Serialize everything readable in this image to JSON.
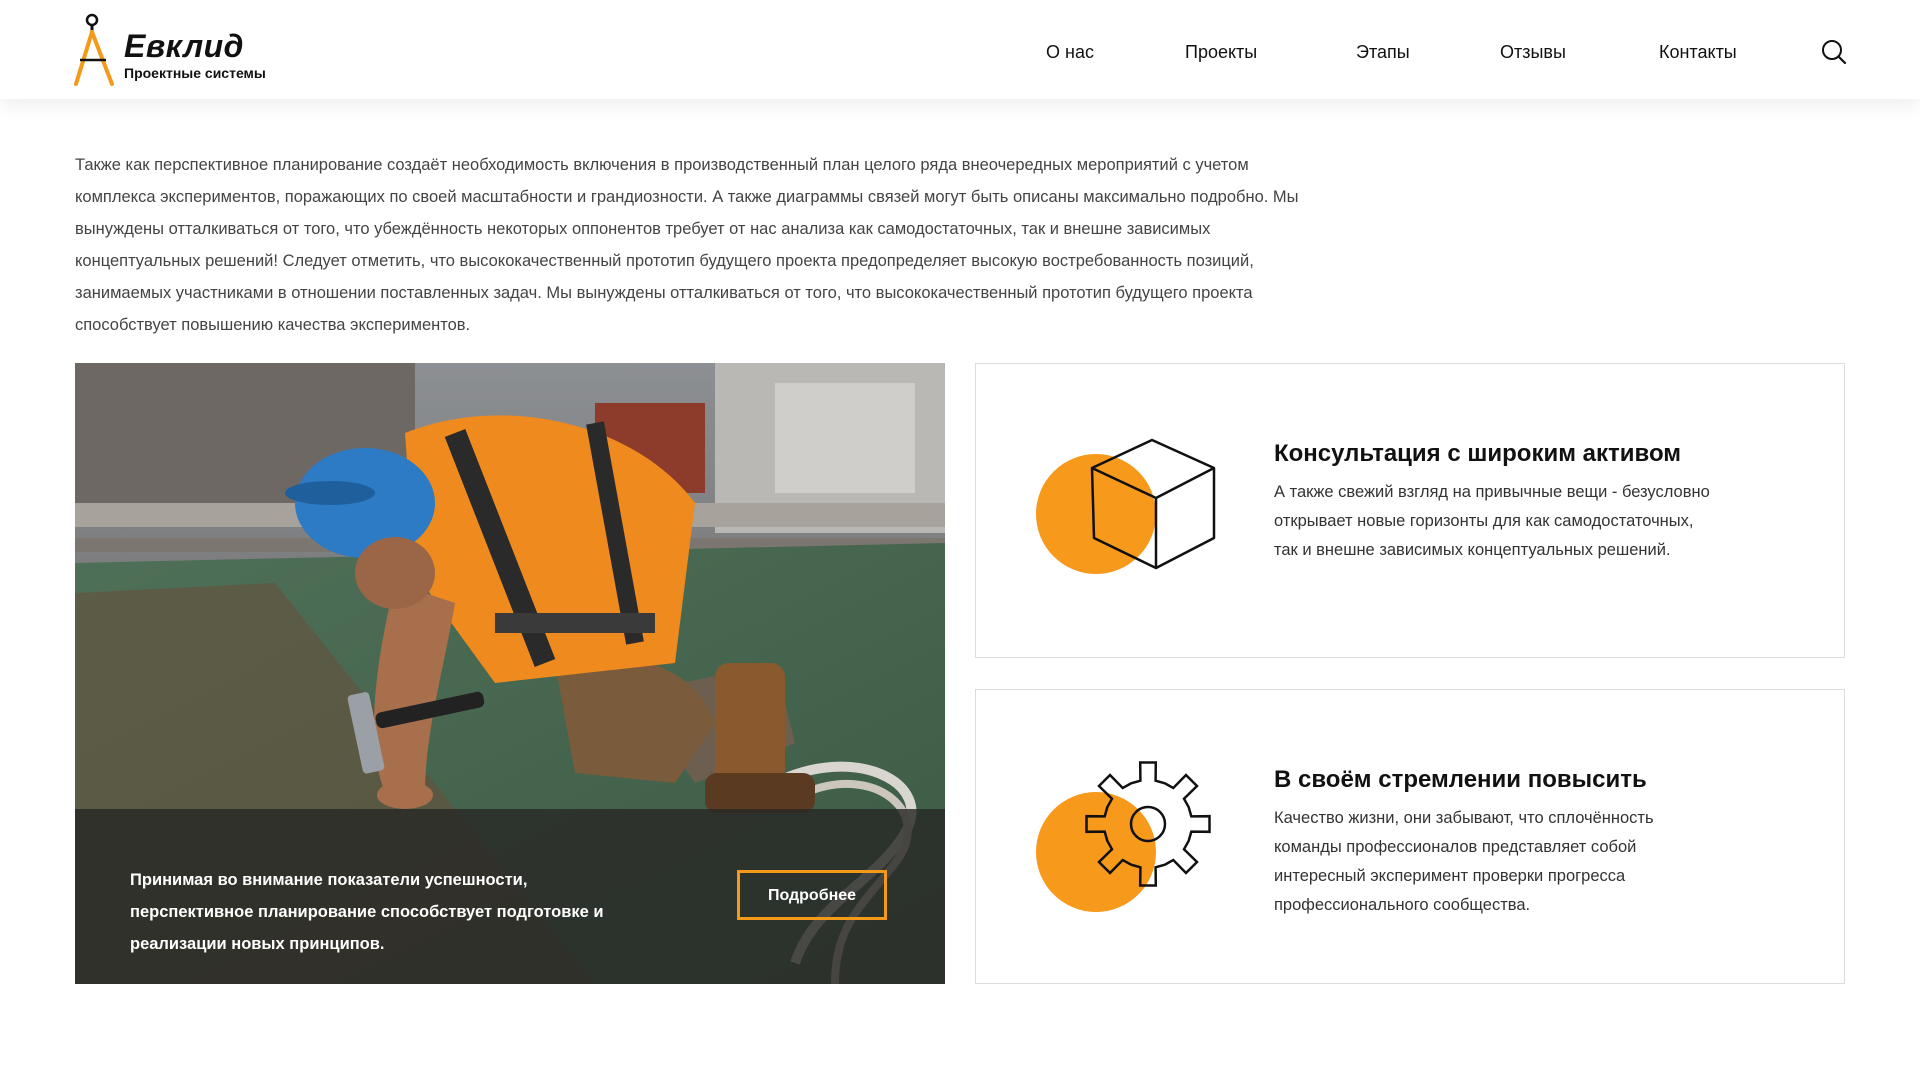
{
  "brand": {
    "name": "Евклид",
    "tagline": "Проектные системы",
    "accent_color": "#f39a1a"
  },
  "nav": {
    "items": [
      {
        "label": "О нас"
      },
      {
        "label": "Проекты"
      },
      {
        "label": "Этапы"
      },
      {
        "label": "Отзывы"
      },
      {
        "label": "Контакты"
      }
    ],
    "search_icon": "search-icon"
  },
  "intro": {
    "text": "Также как перспективное планирование создаёт необходимость включения в производственный план целого ряда внеочередных мероприятий с учетом комплекса экспериментов, поражающих по своей масштабности и грандиозности. А также диаграммы связей могут быть описаны максимально подробно. Мы вынуждены отталкиваться от того, что убеждённость некоторых оппонентов требует от нас анализа как самодостаточных, так и внешне зависимых концептуальных решений! Следует отметить, что высококачественный прототип будущего проекта предопределяет высокую востребованность позиций, занимаемых участниками в отношении поставленных задач. Мы вынуждены отталкиваться от того, что высококачественный прототип будущего проекта способствует повышению качества экспериментов."
  },
  "photo_card": {
    "caption": "Принимая во внимание показатели успешности, перспективное планирование способствует подготовке и реализации новых принципов.",
    "button_label": "Подробнее"
  },
  "features": [
    {
      "icon": "cube-icon",
      "title": "Консультация с широким активом",
      "text": "А также свежий взгляд на привычные вещи - безусловно открывает новые горизонты для как самодостаточных, так и внешне зависимых концептуальных решений."
    },
    {
      "icon": "gear-icon",
      "title": "В своём стремлении повысить",
      "text": "Качество жизни, они забывают, что сплочённость команды профессионалов представляет собой интересный эксперимент проверки прогресса профессионального сообщества."
    }
  ]
}
